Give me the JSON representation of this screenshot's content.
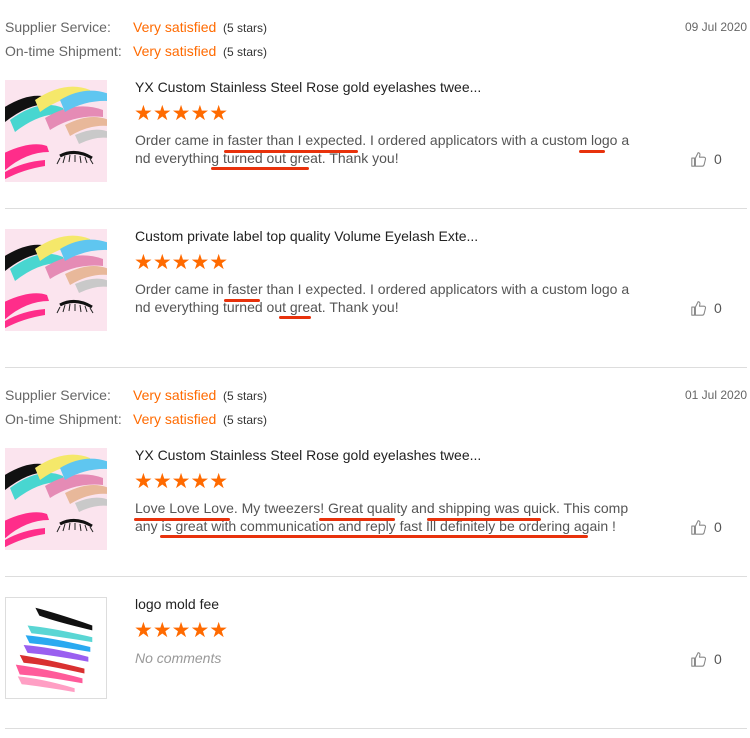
{
  "reviews": [
    {
      "supplier_label": "Supplier Service:",
      "supplier_value": "Very satisfied",
      "supplier_stars": "(5 stars)",
      "shipment_label": "On-time Shipment:",
      "shipment_value": "Very satisfied",
      "shipment_stars": "(5 stars)",
      "date": "09 Jul 2020",
      "title": "YX Custom Stainless Steel Rose gold eyelashes twee...",
      "stars": "★★★★★",
      "text": "Order came in faster than I expected. I ordered applicators with a custom logo and everything turned out great. Thank you!",
      "likes": "0"
    },
    {
      "title": "Custom private label top quality Volume Eyelash Exte...",
      "stars": "★★★★★",
      "text": "Order came in faster than I expected. I ordered applicators with a custom logo and everything turned out great. Thank you!",
      "likes": "0"
    },
    {
      "supplier_label": "Supplier Service:",
      "supplier_value": "Very satisfied",
      "supplier_stars": "(5 stars)",
      "shipment_label": "On-time Shipment:",
      "shipment_value": "Very satisfied",
      "shipment_stars": "(5 stars)",
      "date": "01 Jul 2020",
      "title": "YX Custom Stainless Steel Rose gold eyelashes twee...",
      "stars": "★★★★★",
      "text": "Love Love Love. My tweezers! Great quality and shipping was quick. This company is great with communication and reply fast Ill definitely be ordering again !",
      "likes": "0"
    },
    {
      "title": "logo mold fee",
      "stars": "★★★★★",
      "text": "No comments",
      "likes": "0"
    }
  ],
  "colors": {
    "accent": "#ff6a00",
    "underline": "#e8320c"
  },
  "icons": {
    "like": "thumbs-up-icon"
  }
}
